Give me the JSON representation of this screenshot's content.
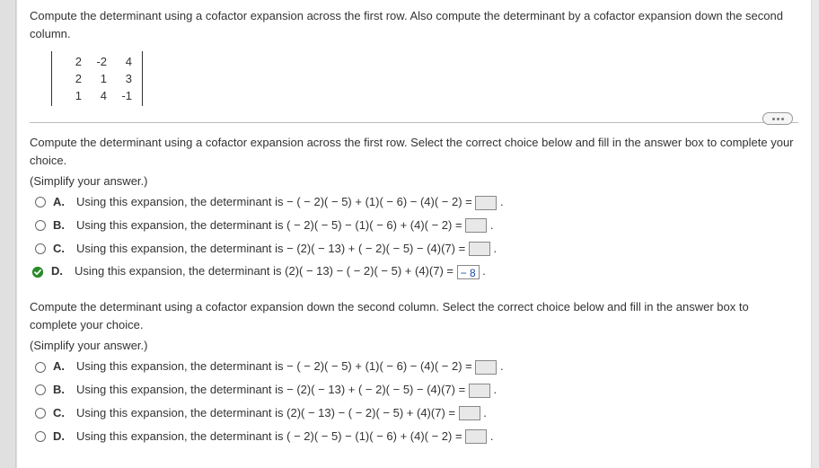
{
  "question": "Compute the determinant using a cofactor expansion across the first row. Also compute the determinant by a cofactor expansion down the second column.",
  "matrix": [
    [
      "2",
      "-2",
      "4"
    ],
    [
      "2",
      "1",
      "3"
    ],
    [
      "1",
      "4",
      "-1"
    ]
  ],
  "part1": {
    "instruction": "Compute the determinant using a cofactor expansion across the first row. Select the correct choice below and fill in the answer box to complete your choice.",
    "simplify": "(Simplify your answer.)",
    "choices": [
      {
        "letter": "A.",
        "prefix": "Using this expansion, the determinant is ",
        "expr": "− ( − 2)( − 5) + (1)( − 6) − (4)( − 2) =",
        "selected": false,
        "value": ""
      },
      {
        "letter": "B.",
        "prefix": "Using this expansion, the determinant is ",
        "expr": "( − 2)( − 5) − (1)( − 6) + (4)( − 2) =",
        "selected": false,
        "value": ""
      },
      {
        "letter": "C.",
        "prefix": "Using this expansion, the determinant is ",
        "expr": "− (2)( − 13) + ( − 2)( − 5) − (4)(7) =",
        "selected": false,
        "value": ""
      },
      {
        "letter": "D.",
        "prefix": "Using this expansion, the determinant is ",
        "expr": "(2)( − 13) − ( − 2)( − 5) + (4)(7) =",
        "selected": true,
        "value": "− 8"
      }
    ]
  },
  "part2": {
    "instruction": "Compute the determinant using a cofactor expansion down the second column. Select the correct choice below and fill in the answer box to complete your choice.",
    "simplify": "(Simplify your answer.)",
    "choices": [
      {
        "letter": "A.",
        "prefix": "Using this expansion, the determinant is ",
        "expr": "− ( − 2)( − 5) + (1)( − 6) − (4)( − 2) =",
        "selected": false,
        "value": ""
      },
      {
        "letter": "B.",
        "prefix": "Using this expansion, the determinant is ",
        "expr": "− (2)( − 13) + ( − 2)( − 5) − (4)(7) =",
        "selected": false,
        "value": ""
      },
      {
        "letter": "C.",
        "prefix": "Using this expansion, the determinant is ",
        "expr": "(2)( − 13) − ( − 2)( − 5) + (4)(7) =",
        "selected": false,
        "value": ""
      },
      {
        "letter": "D.",
        "prefix": "Using this expansion, the determinant is ",
        "expr": "( − 2)( − 5) − (1)( − 6) + (4)( − 2) =",
        "selected": false,
        "value": ""
      }
    ]
  },
  "period": "."
}
